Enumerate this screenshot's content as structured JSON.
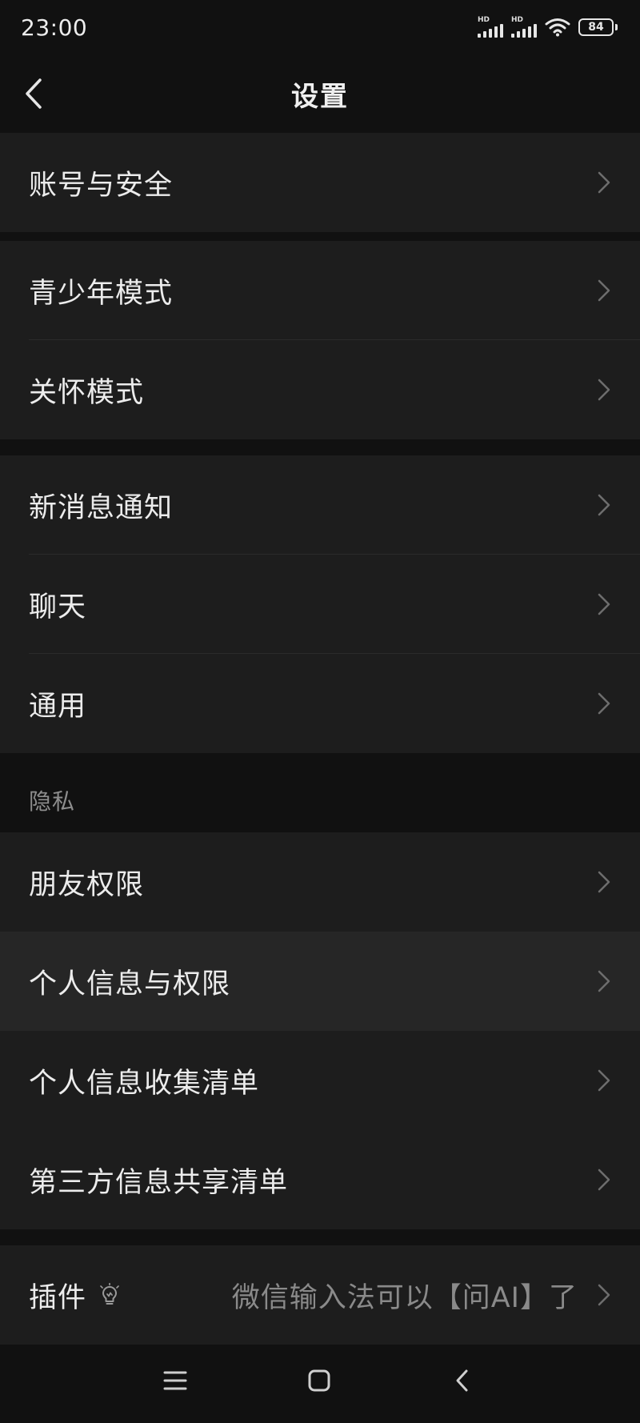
{
  "status_bar": {
    "time": "23:00",
    "signal_1_label": "HD",
    "signal_2_label": "HD",
    "battery_level": "84",
    "icons": [
      "signal-icon",
      "signal-icon",
      "wifi-icon",
      "battery-icon"
    ]
  },
  "header": {
    "title": "设置",
    "back_icon": "chevron-left-icon"
  },
  "groups": [
    {
      "items": [
        {
          "label": "账号与安全"
        }
      ]
    },
    {
      "items": [
        {
          "label": "青少年模式"
        },
        {
          "label": "关怀模式"
        }
      ]
    },
    {
      "items": [
        {
          "label": "新消息通知"
        },
        {
          "label": "聊天"
        },
        {
          "label": "通用"
        }
      ]
    }
  ],
  "privacy": {
    "section_label": "隐私",
    "items": [
      {
        "label": "朋友权限"
      },
      {
        "label": "个人信息与权限",
        "highlighted": true
      },
      {
        "label": "个人信息收集清单"
      },
      {
        "label": "第三方信息共享清单"
      }
    ]
  },
  "plugin": {
    "label": "插件",
    "icon": "lightbulb-icon",
    "hint": "微信输入法可以【问AI】了"
  },
  "system_nav": {
    "icons": [
      "menu-icon",
      "home-icon",
      "back-icon"
    ]
  },
  "colors": {
    "background": "#111111",
    "row_background": "#1d1d1d",
    "row_highlight": "#262626",
    "text_primary": "#ececec",
    "text_secondary": "#8a8a8a"
  }
}
